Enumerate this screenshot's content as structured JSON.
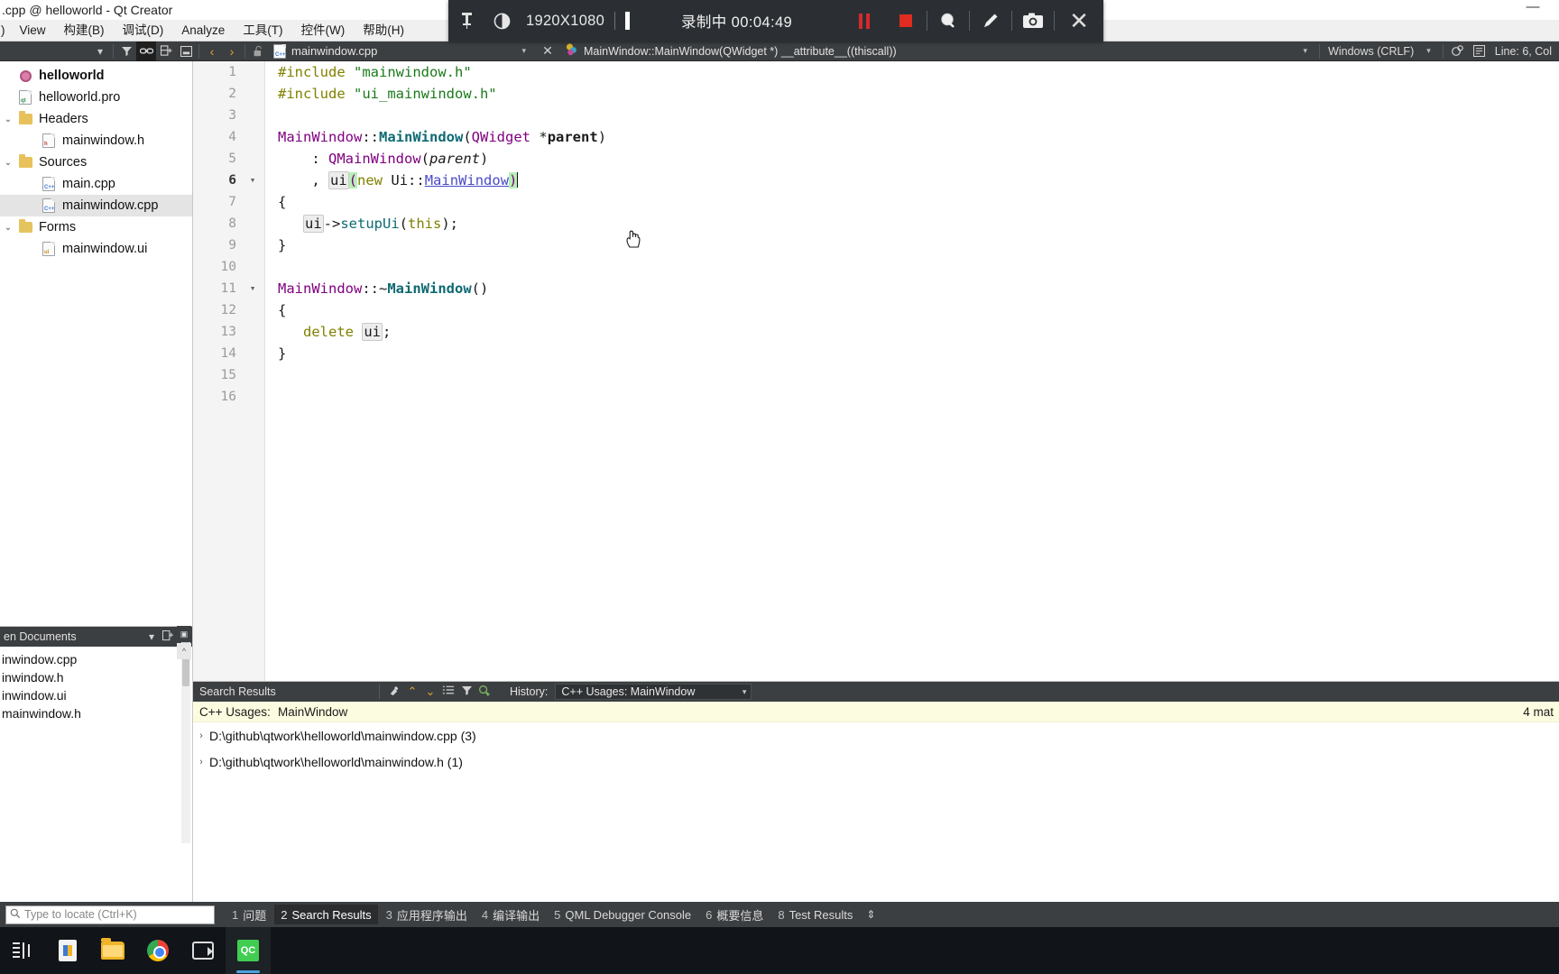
{
  "window": {
    "title": ".cpp @ helloworld - Qt Creator",
    "minimize_icon": "minimize-icon"
  },
  "menubar": {
    "items": [
      {
        "label": ")"
      },
      {
        "label": "View"
      },
      {
        "label": "构建(B)"
      },
      {
        "label": "调试(D)"
      },
      {
        "label": "Analyze"
      },
      {
        "label": "工具(T)"
      },
      {
        "label": "控件(W)"
      },
      {
        "label": "帮助(H)"
      }
    ]
  },
  "recorder": {
    "pin_icon": "pin-icon",
    "contrast_icon": "contrast-icon",
    "resolution": "1920X1080",
    "status": "录制中 00:04:49",
    "pause_icon": "pause-icon",
    "stop_icon": "stop-icon",
    "zoom_icon": "magnifier-icon",
    "pen_icon": "pencil-icon",
    "camera_icon": "camera-icon",
    "close_icon": "close-icon",
    "close_label": "✕"
  },
  "editor_toolbar": {
    "dropdown_icon": "chevron-down-icon",
    "filter_icon": "filter-icon",
    "link_icon": "link-icon",
    "split_icon": "split-horizontal-icon",
    "minimize_icon": "minimize-pane-icon",
    "back_icon": "‹",
    "forward_icon": "›",
    "lock_icon": "unlocked-icon",
    "file_icon": "cpp-file-icon",
    "file_name": "mainwindow.cpp",
    "file_caret": "▾",
    "close_tab_icon": "✕",
    "symbol_icon": "qt-symbol-icon",
    "symbol_name": "MainWindow::MainWindow(QWidget *) __attribute__((thiscall))",
    "symbol_caret": "▾",
    "line_ending": "Windows (CRLF)",
    "line_ending_caret": "▾",
    "encoding_icon": "encoding-icon",
    "wrap_icon": "text-wrap-icon",
    "cursor_position": "Line: 6, Col"
  },
  "project_tree": {
    "nodes": [
      {
        "label": "helloworld",
        "icon": "project-gear-icon",
        "indent": 0,
        "arrow": "",
        "selected": false,
        "bold": true
      },
      {
        "label": "helloworld.pro",
        "icon": "pro-file-icon",
        "indent": 1,
        "arrow": "",
        "selected": false,
        "bold": false
      },
      {
        "label": "Headers",
        "icon": "folder-headers-icon",
        "indent": 0,
        "arrow": "⌄",
        "selected": false,
        "bold": false
      },
      {
        "label": "mainwindow.h",
        "icon": "h-file-icon",
        "indent": 2,
        "arrow": "",
        "selected": false,
        "bold": false
      },
      {
        "label": "Sources",
        "icon": "folder-sources-icon",
        "indent": 0,
        "arrow": "⌄",
        "selected": false,
        "bold": false
      },
      {
        "label": "main.cpp",
        "icon": "cpp-file-icon",
        "indent": 2,
        "arrow": "",
        "selected": false,
        "bold": false
      },
      {
        "label": "mainwindow.cpp",
        "icon": "cpp-file-icon",
        "indent": 2,
        "arrow": "",
        "selected": true,
        "bold": false
      },
      {
        "label": "Forms",
        "icon": "folder-forms-icon",
        "indent": 0,
        "arrow": "⌄",
        "selected": false,
        "bold": false
      },
      {
        "label": "mainwindow.ui",
        "icon": "ui-file-icon",
        "indent": 2,
        "arrow": "",
        "selected": false,
        "bold": false
      }
    ]
  },
  "open_documents": {
    "header": "en Documents",
    "caret": "▾",
    "add_icon": "split-add-icon",
    "close_icon": "close-pane-icon",
    "items": [
      {
        "label": "inwindow.cpp"
      },
      {
        "label": "inwindow.h"
      },
      {
        "label": "inwindow.ui"
      },
      {
        "label": "mainwindow.h"
      }
    ]
  },
  "code": {
    "lines": [
      {
        "n": "1",
        "fold": "",
        "current": false
      },
      {
        "n": "2",
        "fold": "",
        "current": false
      },
      {
        "n": "3",
        "fold": "",
        "current": false
      },
      {
        "n": "4",
        "fold": "",
        "current": false
      },
      {
        "n": "5",
        "fold": "",
        "current": false
      },
      {
        "n": "6",
        "fold": "▾",
        "current": true
      },
      {
        "n": "7",
        "fold": "",
        "current": false
      },
      {
        "n": "8",
        "fold": "",
        "current": false
      },
      {
        "n": "9",
        "fold": "",
        "current": false
      },
      {
        "n": "10",
        "fold": "",
        "current": false
      },
      {
        "n": "11",
        "fold": "▾",
        "current": false
      },
      {
        "n": "12",
        "fold": "",
        "current": false
      },
      {
        "n": "13",
        "fold": "",
        "current": false
      },
      {
        "n": "14",
        "fold": "",
        "current": false
      },
      {
        "n": "15",
        "fold": "",
        "current": false
      },
      {
        "n": "16",
        "fold": "",
        "current": false
      }
    ],
    "text": [
      "#include \"mainwindow.h\"",
      "#include \"ui_mainwindow.h\"",
      "",
      "MainWindow::MainWindow(QWidget *parent)",
      "    : QMainWindow(parent)",
      "    , ui(new Ui::MainWindow)",
      "{",
      "    ui->setupUi(this);",
      "}",
      "",
      "MainWindow::~MainWindow()",
      "{",
      "    delete ui;",
      "}",
      "",
      ""
    ]
  },
  "search_results": {
    "title": "Search Results",
    "clear_icon": "clear-results-icon",
    "prev_icon": "chevron-up-icon",
    "next_icon": "chevron-down-icon",
    "list_icon": "expand-all-icon",
    "filter_icon": "filter-icon",
    "newsearch_icon": "new-search-icon",
    "history_label": "History:",
    "history_value": "C++ Usages: MainWindow",
    "history_caret": "▾",
    "banner_label": "C++ Usages:",
    "banner_value": "MainWindow",
    "match_count": "4 mat",
    "rows": [
      {
        "expander": "›",
        "path": "D:\\github\\qtwork\\helloworld\\mainwindow.cpp (3)"
      },
      {
        "expander": "›",
        "path": "D:\\github\\qtwork\\helloworld\\mainwindow.h (1)"
      }
    ]
  },
  "status_bar": {
    "locate_placeholder": "Type to locate (Ctrl+K)",
    "search_icon": "search-icon",
    "tabs": [
      {
        "num": "1",
        "label": "问题",
        "active": false
      },
      {
        "num": "2",
        "label": "Search Results",
        "active": true
      },
      {
        "num": "3",
        "label": "应用程序输出",
        "active": false
      },
      {
        "num": "4",
        "label": "编译输出",
        "active": false
      },
      {
        "num": "5",
        "label": "QML Debugger Console",
        "active": false
      },
      {
        "num": "6",
        "label": "概要信息",
        "active": false
      },
      {
        "num": "8",
        "label": "Test Results",
        "active": false
      }
    ],
    "spinner": "⇕"
  },
  "taskbar": {
    "items": [
      {
        "icon": "task-view-icon",
        "active": false
      },
      {
        "icon": "microsoft-store-icon",
        "active": false
      },
      {
        "icon": "file-explorer-icon",
        "active": false
      },
      {
        "icon": "chrome-icon",
        "active": false
      },
      {
        "icon": "screen-recorder-icon",
        "active": false
      },
      {
        "icon": "qt-creator-icon",
        "active": true,
        "badge": "QC"
      }
    ]
  },
  "colors": {
    "recorder_bg": "#2b2f33",
    "record_red": "#e02b20",
    "toolbar_dark": "#3c3f41",
    "banner_yellow": "#fcfce0",
    "selection_green": "#b6f0b6",
    "qt_green": "#41cd52"
  }
}
